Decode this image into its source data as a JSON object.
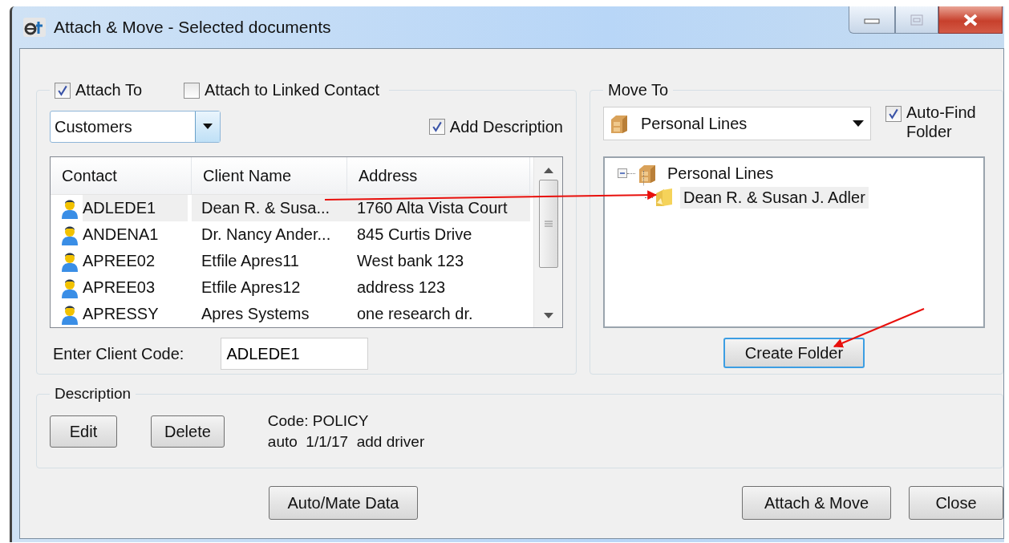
{
  "window": {
    "title": "Attach & Move - Selected documents"
  },
  "attach": {
    "attach_to": {
      "label": "Attach To",
      "checked": true
    },
    "linked": {
      "label": "Attach to Linked Contact",
      "checked": false
    },
    "category": {
      "value": "Customers"
    },
    "add_description": {
      "label": "Add Description",
      "checked": true
    },
    "table": {
      "columns": [
        "Contact",
        "Client Name",
        "Address"
      ],
      "rows": [
        {
          "contact": "ADLEDE1",
          "client_name": "Dean R. & Susa...",
          "address": "1760 Alta Vista Court",
          "selected": true
        },
        {
          "contact": "ANDENA1",
          "client_name": "Dr. Nancy Ander...",
          "address": "845 Curtis Drive",
          "selected": false
        },
        {
          "contact": "APREE02",
          "client_name": "Etfile Apres11",
          "address": "West bank 123",
          "selected": false
        },
        {
          "contact": "APREE03",
          "client_name": "Etfile Apres12",
          "address": "address 123",
          "selected": false
        },
        {
          "contact": "APRESSY",
          "client_name": "Apres Systems",
          "address": "one research dr.",
          "selected": false
        }
      ]
    },
    "client_code": {
      "label": "Enter Client Code:",
      "value": "ADLEDE1"
    }
  },
  "move_to": {
    "title": "Move To",
    "folder": {
      "value": "Personal Lines"
    },
    "auto_find": {
      "label": "Auto-Find Folder",
      "checked": true
    },
    "tree": [
      {
        "label": "Personal Lines",
        "expanded": true,
        "selected": false,
        "children": [
          {
            "label": "Dean R. & Susan J. Adler",
            "selected": true
          }
        ]
      }
    ],
    "create_button": "Create Folder"
  },
  "description": {
    "title": "Description",
    "buttons": [
      "Edit",
      "Delete"
    ],
    "lines": [
      "Code: POLICY",
      "auto  1/1/17  add driver"
    ]
  },
  "buttons": [
    "Auto/Mate Data",
    "Attach & Move",
    "Close"
  ]
}
